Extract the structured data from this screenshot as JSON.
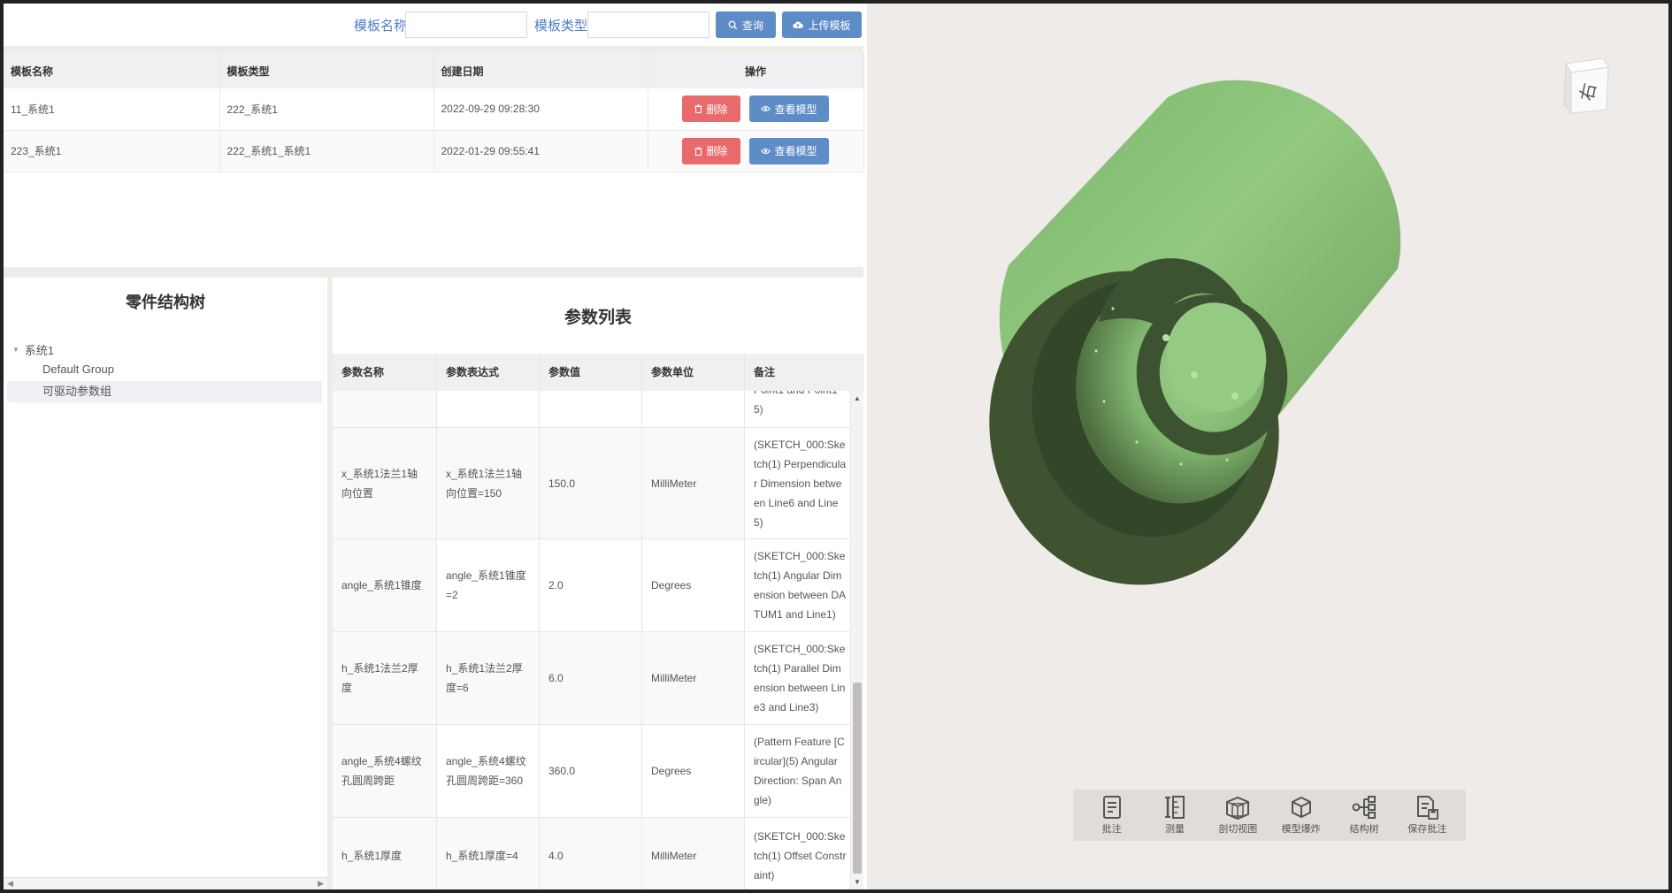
{
  "search": {
    "name_label": "模板名称",
    "name_placeholder": "",
    "type_label": "模板类型",
    "type_placeholder": "",
    "query_label": "查询",
    "upload_label": "上传模板"
  },
  "template_table": {
    "columns": [
      "模板名称",
      "模板类型",
      "创建日期",
      "操作"
    ],
    "rows": [
      {
        "name": "11_系统1",
        "type": "222_系统1",
        "date": "2022-09-29 09:28:30"
      },
      {
        "name": "223_系统1",
        "type": "222_系统1_系统1",
        "date": "2022-01-29 09:55:41"
      }
    ],
    "delete_label": "删除",
    "view_label": "查看模型"
  },
  "tree": {
    "title": "零件结构树",
    "root": "系统1",
    "children": [
      "Default Group",
      "可驱动参数组"
    ]
  },
  "params": {
    "title": "参数列表",
    "columns": [
      "参数名称",
      "参数表达式",
      "参数值",
      "参数单位",
      "备注"
    ],
    "rows": [
      {
        "name": "",
        "expr": "",
        "value": "",
        "unit": "",
        "note": "Point1 and Point1 5)"
      },
      {
        "name": "x_系统1法兰1轴向位置",
        "expr": "x_系统1法兰1轴向位置=150",
        "value": "150.0",
        "unit": "MilliMeter",
        "note": "(SKETCH_000:Sketch(1) Perpendicular Dimension between Line6 and Line5)"
      },
      {
        "name": "angle_系统1锥度",
        "expr": "angle_系统1锥度=2",
        "value": "2.0",
        "unit": "Degrees",
        "note": "(SKETCH_000:Sketch(1) Angular Dimension between DATUM1 and Line1)"
      },
      {
        "name": "h_系统1法兰2厚度",
        "expr": "h_系统1法兰2厚度=6",
        "value": "6.0",
        "unit": "MilliMeter",
        "note": "(SKETCH_000:Sketch(1) Parallel Dimension between Line3 and Line3)"
      },
      {
        "name": "angle_系统4螺纹孔圆周跨距",
        "expr": "angle_系统4螺纹孔圆周跨距=360",
        "value": "360.0",
        "unit": "Degrees",
        "note": "(Pattern Feature [Circular](5) Angular Direction: Span Angle)"
      },
      {
        "name": "h_系统1厚度",
        "expr": "h_系统1厚度=4",
        "value": "4.0",
        "unit": "MilliMeter",
        "note": "(SKETCH_000:Sketch(1) Offset Constraint)"
      }
    ]
  },
  "viewer": {
    "cube_label": "右",
    "tools": [
      {
        "label": "批注",
        "icon": "annotate-icon"
      },
      {
        "label": "测量",
        "icon": "measure-icon"
      },
      {
        "label": "剖切视图",
        "icon": "section-view-icon"
      },
      {
        "label": "模型爆炸",
        "icon": "explode-icon"
      },
      {
        "label": "结构树",
        "icon": "structure-tree-icon"
      },
      {
        "label": "保存批注",
        "icon": "save-annotation-icon"
      }
    ],
    "colors": {
      "model": "#8cc47a",
      "model_dark": "#3f5330",
      "background": "#efebe8"
    }
  }
}
